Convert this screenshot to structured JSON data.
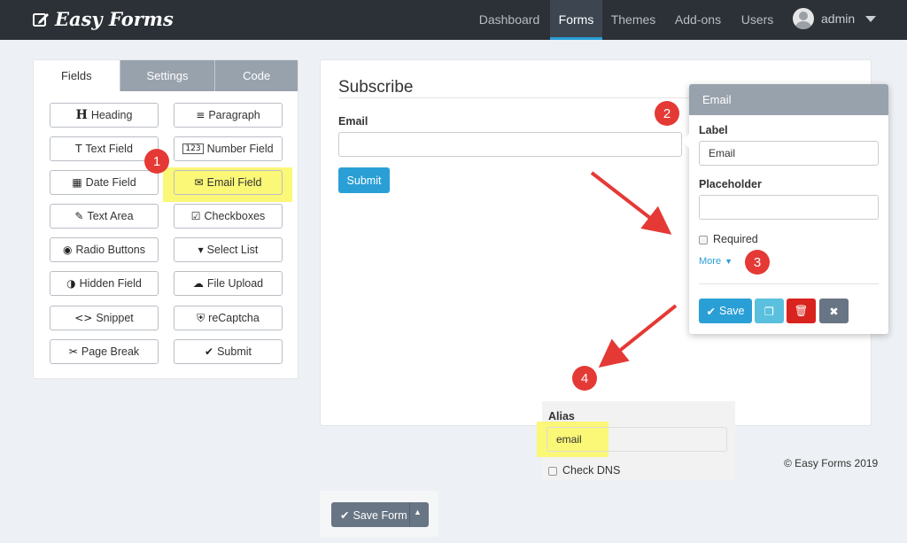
{
  "brand": {
    "name": "Easy Forms"
  },
  "nav": {
    "items": [
      {
        "label": "Dashboard"
      },
      {
        "label": "Forms"
      },
      {
        "label": "Themes"
      },
      {
        "label": "Add-ons"
      },
      {
        "label": "Users"
      }
    ],
    "user": "admin"
  },
  "fields_panel": {
    "tabs": [
      {
        "label": "Fields"
      },
      {
        "label": "Settings"
      },
      {
        "label": "Code"
      }
    ],
    "buttons": [
      {
        "label": "Heading",
        "icon": "heading-icon",
        "glyph": "H"
      },
      {
        "label": "Paragraph",
        "icon": "paragraph-icon",
        "glyph": "≡"
      },
      {
        "label": "Text Field",
        "icon": "text-field-icon",
        "glyph": "T"
      },
      {
        "label": "Number Field",
        "icon": "number-field-icon",
        "glyph": "123"
      },
      {
        "label": "Date Field",
        "icon": "calendar-icon",
        "glyph": "▦"
      },
      {
        "label": "Email Field",
        "icon": "envelope-icon",
        "glyph": "✉"
      },
      {
        "label": "Text Area",
        "icon": "edit-icon",
        "glyph": "✎"
      },
      {
        "label": "Checkboxes",
        "icon": "checkbox-icon",
        "glyph": "☑"
      },
      {
        "label": "Radio Buttons",
        "icon": "radio-icon",
        "glyph": "◉"
      },
      {
        "label": "Select List",
        "icon": "select-icon",
        "glyph": "▾"
      },
      {
        "label": "Hidden Field",
        "icon": "hidden-icon",
        "glyph": "◑"
      },
      {
        "label": "File Upload",
        "icon": "upload-icon",
        "glyph": "☁"
      },
      {
        "label": "Snippet",
        "icon": "code-icon",
        "glyph": "<>"
      },
      {
        "label": "reCaptcha",
        "icon": "shield-icon",
        "glyph": "⛨"
      },
      {
        "label": "Page Break",
        "icon": "scissors-icon",
        "glyph": "✂"
      },
      {
        "label": "Submit",
        "icon": "check-icon",
        "glyph": "✔"
      }
    ]
  },
  "form": {
    "title": "Subscribe",
    "email_label": "Email",
    "submit_label": "Submit"
  },
  "popover": {
    "title": "Email",
    "label_label": "Label",
    "label_value": "Email",
    "placeholder_label": "Placeholder",
    "placeholder_value": "",
    "required_label": "Required",
    "more_label": "More",
    "save_label": "Save"
  },
  "alias": {
    "label": "Alias",
    "value": "email",
    "check_dns_label": "Check DNS"
  },
  "footer": {
    "copyright": "© Easy Forms 2019"
  },
  "save_form": {
    "label": "Save Form"
  },
  "annotations": {
    "one": "1",
    "two": "2",
    "three": "3",
    "four": "4"
  },
  "colors": {
    "navbar": "#2b3137",
    "primary": "#2a9fd6",
    "info": "#5bc0de",
    "danger": "#d9231e",
    "muted": "#677584",
    "highlight": "#fbf777",
    "annotation": "#e53935"
  }
}
